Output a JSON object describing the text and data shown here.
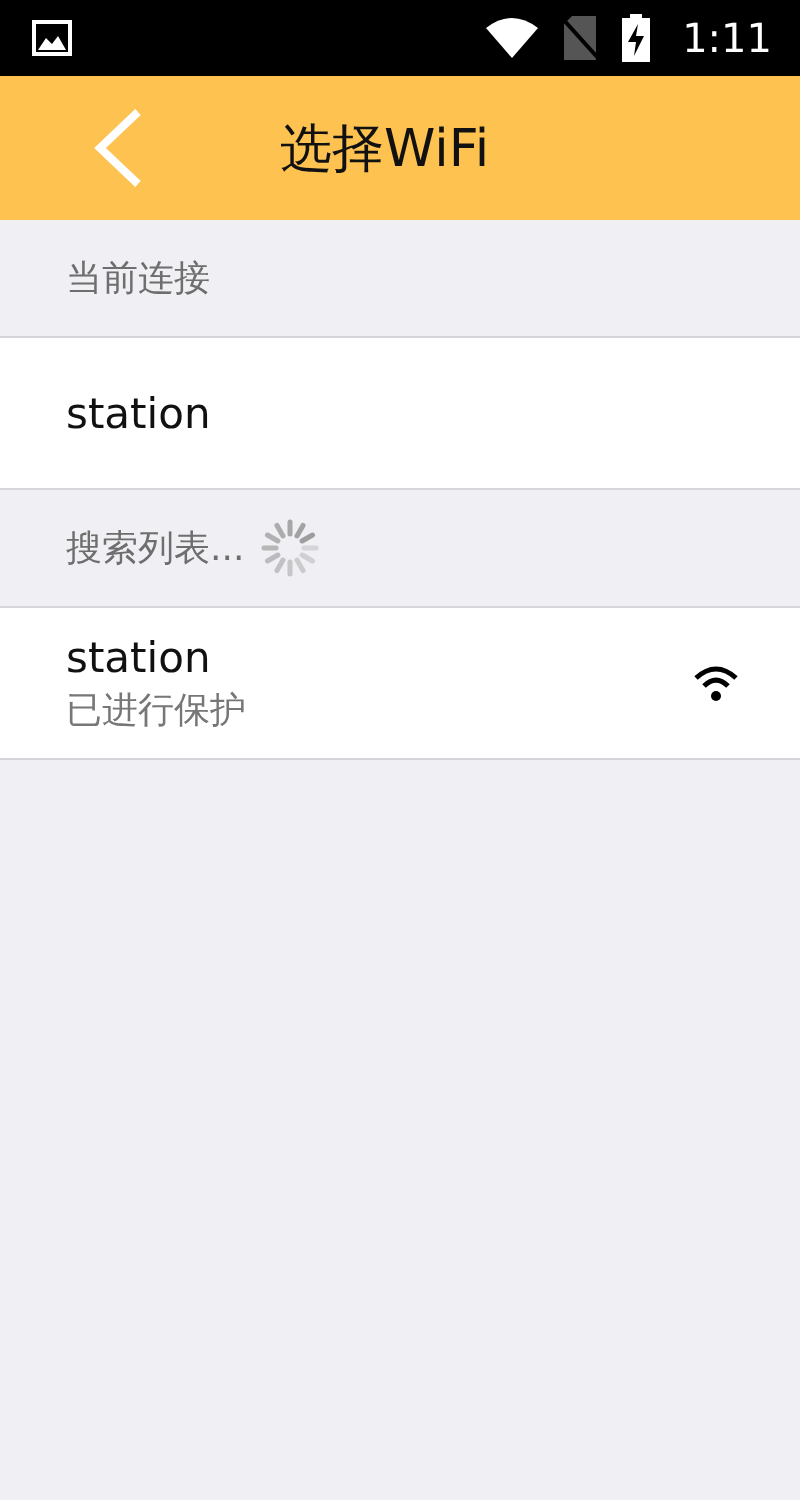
{
  "status_bar": {
    "time": "1:11"
  },
  "header": {
    "title": "选择WiFi"
  },
  "current_section": {
    "label": "当前连接"
  },
  "current_network": {
    "name": "station"
  },
  "search_section": {
    "label": "搜索列表..."
  },
  "networks": [
    {
      "name": "station",
      "status": "已进行保护"
    }
  ]
}
